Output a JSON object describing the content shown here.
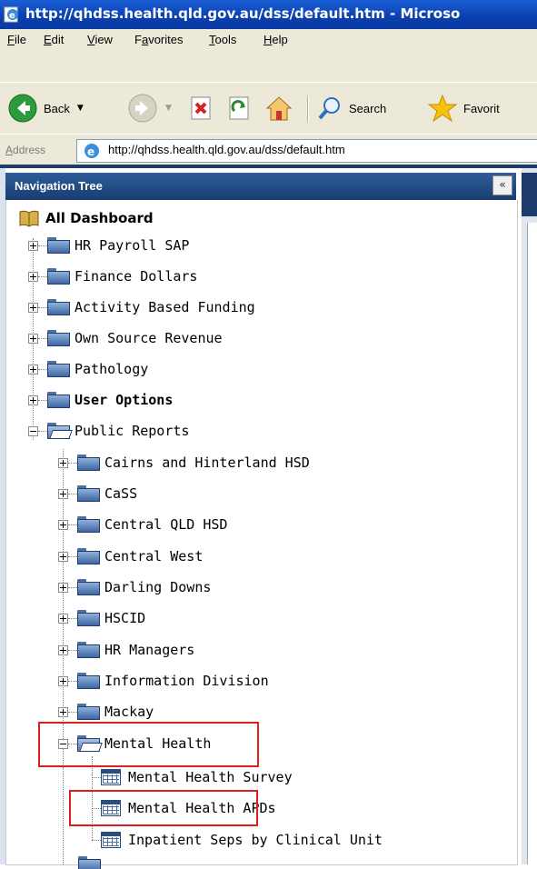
{
  "window": {
    "title": "http://qhdss.health.qld.gov.au/dss/default.htm - Microso",
    "icon": "ie-page-icon"
  },
  "menubar": {
    "items": [
      {
        "label": "File",
        "ul": "F",
        "rest": "ile"
      },
      {
        "label": "Edit",
        "ul": "E",
        "rest": "dit"
      },
      {
        "label": "View",
        "ul": "V",
        "rest": "iew"
      },
      {
        "label": "Favorites",
        "pre": "F",
        "ul": "a",
        "rest": "vorites"
      },
      {
        "label": "Tools",
        "ul": "T",
        "rest": "ools"
      },
      {
        "label": "Help",
        "ul": "H",
        "rest": "elp"
      }
    ]
  },
  "toolbar": {
    "back_label": "Back",
    "search_label": "Search",
    "favorites_label": "Favorit"
  },
  "address": {
    "label": "Address",
    "url": "http://qhdss.health.qld.gov.au/dss/default.htm"
  },
  "nav": {
    "header": "Navigation Tree",
    "collapse_glyph": "«",
    "root": "All Dashboard",
    "top_items": [
      {
        "label": "HR Payroll SAP"
      },
      {
        "label": "Finance Dollars"
      },
      {
        "label": "Activity Based Funding"
      },
      {
        "label": "Own Source Revenue"
      },
      {
        "label": "Pathology"
      },
      {
        "label": "User Options"
      },
      {
        "label": "Public Reports"
      }
    ],
    "public_reports": [
      {
        "label": "Cairns and Hinterland HSD"
      },
      {
        "label": "CaSS"
      },
      {
        "label": "Central QLD HSD"
      },
      {
        "label": "Central West"
      },
      {
        "label": "Darling Downs"
      },
      {
        "label": "HSCID"
      },
      {
        "label": "HR Managers"
      },
      {
        "label": "Information Division"
      },
      {
        "label": "Mackay"
      },
      {
        "label": "Mental Health"
      }
    ],
    "mental_health": [
      {
        "label": "Mental Health Survey"
      },
      {
        "label": "Mental Health APDs"
      },
      {
        "label": "Inpatient Seps by Clinical Unit"
      }
    ]
  },
  "colors": {
    "titlebar": "#0a3fae",
    "nav_header": "#234c85",
    "highlight_box": "#e02020"
  }
}
